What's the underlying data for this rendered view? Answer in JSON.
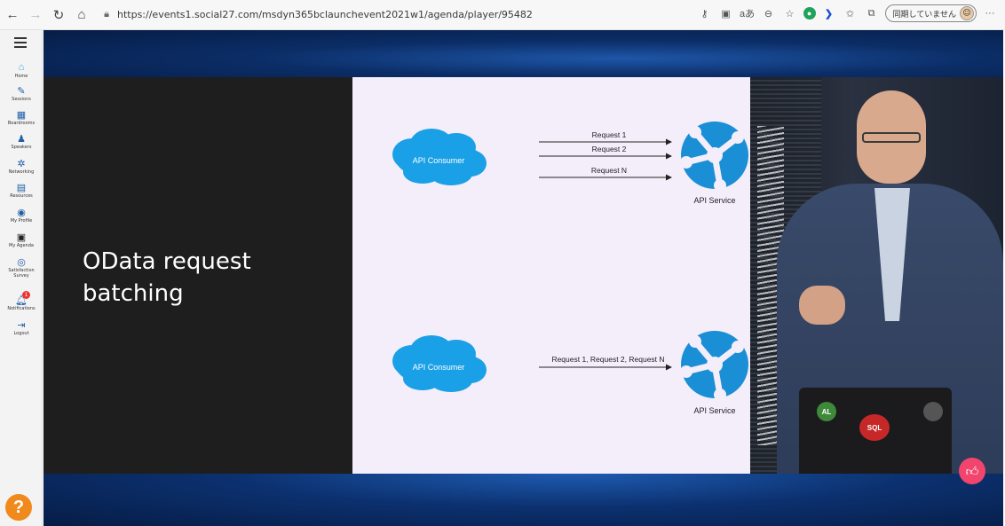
{
  "browser": {
    "url": "https://events1.social27.com/msdyn365bclaunchevent2021w1/agenda/player/95482",
    "sync_label": "同期していません"
  },
  "sidebar": {
    "items": [
      {
        "label": "Home",
        "icon": "home-icon"
      },
      {
        "label": "Sessions",
        "icon": "pencil-icon"
      },
      {
        "label": "Boardrooms",
        "icon": "boardroom-icon"
      },
      {
        "label": "Speakers",
        "icon": "speaker-icon"
      },
      {
        "label": "Networking",
        "icon": "networking-icon"
      },
      {
        "label": "Resources",
        "icon": "resources-icon"
      },
      {
        "label": "My Profile",
        "icon": "profile-icon"
      },
      {
        "label": "My Agenda",
        "icon": "calendar-icon"
      },
      {
        "label": "Satisfaction\nSurvey",
        "icon": "survey-icon"
      },
      {
        "label": "Notifications",
        "icon": "bell-icon",
        "badge": "1"
      },
      {
        "label": "Logout",
        "icon": "logout-icon"
      }
    ],
    "help_label": "?"
  },
  "slide": {
    "title": "OData request\nbatching",
    "top": {
      "consumer": "API Consumer",
      "requests": [
        "Request 1",
        "Request 2",
        "Request N"
      ],
      "service": "API Service"
    },
    "bottom": {
      "consumer": "API Consumer",
      "request": "Request 1, Request 2, Request N",
      "service": "API Service"
    }
  },
  "video": {
    "stickers": [
      "AL",
      "SQL"
    ]
  },
  "colors": {
    "cloud": "#1aa0e6",
    "service": "#1a8fd6",
    "like": "#f2456e",
    "help": "#f08a1c"
  }
}
